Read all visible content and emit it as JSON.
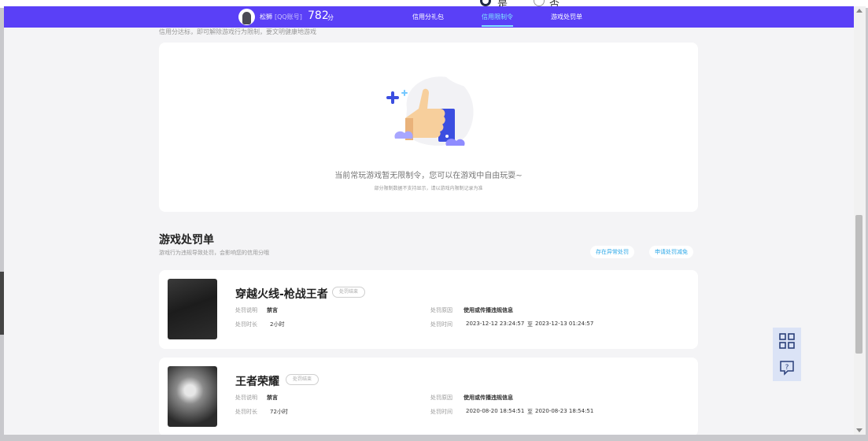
{
  "background": {
    "radio_yes": "是",
    "radio_no": "否"
  },
  "header": {
    "user_name": "松狮",
    "account_type": "[QQ账号]",
    "score": "782",
    "score_unit": "分",
    "tabs": [
      {
        "label": "信用分礼包",
        "active": false
      },
      {
        "label": "信用限制令",
        "active": true
      },
      {
        "label": "游戏处罚单",
        "active": false
      }
    ]
  },
  "restriction": {
    "hint": "信用分达标，即可解除游戏行为限制，要文明健康地游戏",
    "empty_title": "当前常玩游戏暂无限制令，您可以在游戏中自由玩耍~",
    "empty_subtitle": "部分限制数据不支持显示，请以游戏内限制记录为准"
  },
  "penalty": {
    "title": "游戏处罚单",
    "subtitle": "游戏行为违规导致处罚，会影响您的信用分哦",
    "report_button": "存在异常处罚",
    "appeal_button": "申请处罚减免",
    "labels": {
      "desc": "处罚说明",
      "duration": "处罚时长",
      "reason": "处罚原因",
      "time": "处罚时间"
    },
    "records": [
      {
        "game": "穿越火线-枪战王者",
        "status": "处罚结束",
        "desc": "禁言",
        "duration": "2小时",
        "reason": "使用或传播违规信息",
        "start": "2023-12-12 23:24:57",
        "to": "至",
        "end": "2023-12-13 01:24:57"
      },
      {
        "game": "王者荣耀",
        "status": "处罚结束",
        "desc": "禁言",
        "duration": "72小时",
        "reason": "使用或传播违规信息",
        "start": "2020-08-20 18:54:51",
        "to": "至",
        "end": "2020-08-23 18:54:51"
      }
    ]
  },
  "icons": {
    "qrcode": "qrcode-icon",
    "help": "help-icon"
  },
  "colors": {
    "topbar": "#5a40f7",
    "active_tab": "#7fe2ff",
    "link": "#2aa7e8"
  }
}
